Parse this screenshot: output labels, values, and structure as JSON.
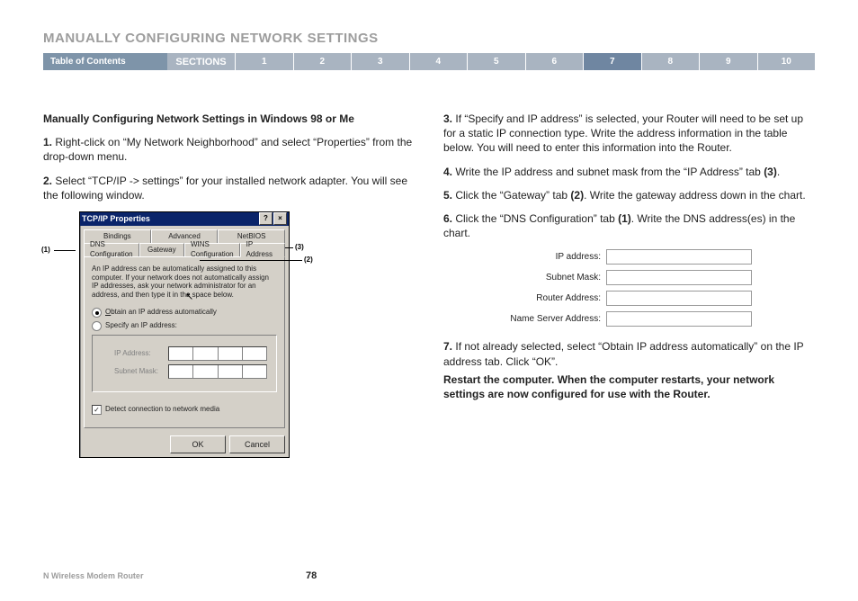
{
  "title": "MANUALLY CONFIGURING NETWORK SETTINGS",
  "nav": {
    "toc": "Table of Contents",
    "sections": "SECTIONS",
    "tabs": [
      "1",
      "2",
      "3",
      "4",
      "5",
      "6",
      "7",
      "8",
      "9",
      "10"
    ],
    "active": "7"
  },
  "left": {
    "heading": "Manually Configuring Network Settings in Windows 98 or Me",
    "steps": [
      "Right-click on “My Network Neighborhood” and select “Properties” from the drop-down menu.",
      "Select “TCP/IP -> settings” for your installed network adapter. You will see the following window."
    ]
  },
  "right": {
    "steps": [
      "If “Specify and IP address” is selected, your Router will need to be set up for a static IP connection type. Write the address information in the table below. You will need to enter this information into the Router.",
      "Write the IP address and subnet mask from the “IP Address” tab (3).",
      "Click the “Gateway” tab (2). Write the gateway address down in the chart.",
      "Click the “DNS Configuration” tab (1). Write the DNS address(es) in the chart.",
      "If not already selected, select “Obtain IP address automatically” on the IP address tab. Click “OK”."
    ],
    "addr_labels": [
      "IP address:",
      "Subnet Mask:",
      "Router Address:",
      "Name Server Address:"
    ],
    "restart": "Restart the computer. When the computer restarts, your network settings are now configured for use with the Router."
  },
  "dialog": {
    "title": "TCP/IP Properties",
    "tabs_row1": [
      "Bindings",
      "Advanced",
      "NetBIOS"
    ],
    "tabs_row2": [
      "DNS Configuration",
      "Gateway",
      "WINS Configuration",
      "IP Address"
    ],
    "note": "An IP address can be automatically assigned to this computer. If your network does not automatically assign IP addresses, ask your network administrator for an address, and then type it in the space below.",
    "radio1": "Obtain an IP address automatically",
    "radio2": "Specify an IP address:",
    "ip_label": "IP Address:",
    "mask_label": "Subnet Mask:",
    "detect": "Detect connection to network media",
    "ok": "OK",
    "cancel": "Cancel",
    "callouts": {
      "c1": "(1)",
      "c2": "(2)",
      "c3": "(3)"
    }
  },
  "footer": {
    "product": "N Wireless Modem Router",
    "page": "78"
  }
}
